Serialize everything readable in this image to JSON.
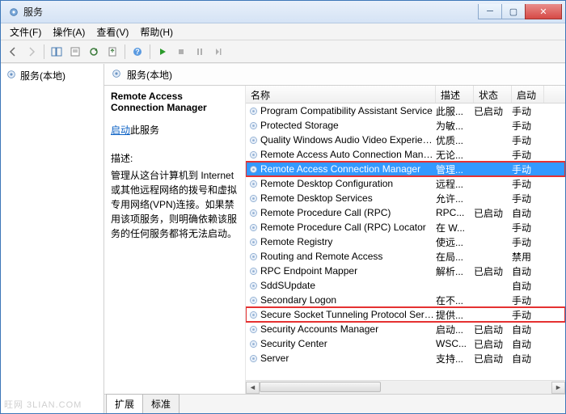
{
  "window": {
    "title": "服务"
  },
  "menu": {
    "file": "文件(F)",
    "action": "操作(A)",
    "view": "查看(V)",
    "help": "帮助(H)"
  },
  "tree": {
    "root": "服务(本地)"
  },
  "rhead": {
    "title": "服务(本地)"
  },
  "detail": {
    "name": "Remote Access Connection Manager",
    "start_link": "启动",
    "start_suffix": "此服务",
    "desc_label": "描述:",
    "desc": "管理从这台计算机到 Internet 或其他远程网络的拨号和虚拟专用网络(VPN)连接。如果禁用该项服务，则明确依赖该服务的任何服务都将无法启动。"
  },
  "cols": {
    "c1": "名称",
    "c2": "描述",
    "c3": "状态",
    "c4": "启动"
  },
  "rows": [
    {
      "n": "Program Compatibility Assistant Service",
      "d2": "此服...",
      "d3": "已启动",
      "d4": "手动"
    },
    {
      "n": "Protected Storage",
      "d2": "为敏...",
      "d3": "",
      "d4": "手动"
    },
    {
      "n": "Quality Windows Audio Video Experience",
      "d2": "优质...",
      "d3": "",
      "d4": "手动"
    },
    {
      "n": "Remote Access Auto Connection Manager",
      "d2": "无论...",
      "d3": "",
      "d4": "手动"
    },
    {
      "n": "Remote Access Connection Manager",
      "d2": "管理...",
      "d3": "",
      "d4": "手动",
      "sel": true,
      "hl": true
    },
    {
      "n": "Remote Desktop Configuration",
      "d2": "远程...",
      "d3": "",
      "d4": "手动"
    },
    {
      "n": "Remote Desktop Services",
      "d2": "允许...",
      "d3": "",
      "d4": "手动"
    },
    {
      "n": "Remote Procedure Call (RPC)",
      "d2": "RPC...",
      "d3": "已启动",
      "d4": "自动"
    },
    {
      "n": "Remote Procedure Call (RPC) Locator",
      "d2": "在 W...",
      "d3": "",
      "d4": "手动"
    },
    {
      "n": "Remote Registry",
      "d2": "使远...",
      "d3": "",
      "d4": "手动"
    },
    {
      "n": "Routing and Remote Access",
      "d2": "在局...",
      "d3": "",
      "d4": "禁用"
    },
    {
      "n": "RPC Endpoint Mapper",
      "d2": "解析...",
      "d3": "已启动",
      "d4": "自动"
    },
    {
      "n": "SddSUpdate",
      "d2": "",
      "d3": "",
      "d4": "自动"
    },
    {
      "n": "Secondary Logon",
      "d2": "在不...",
      "d3": "",
      "d4": "手动"
    },
    {
      "n": "Secure Socket Tunneling Protocol Service",
      "d2": "提供...",
      "d3": "",
      "d4": "手动",
      "hl": true
    },
    {
      "n": "Security Accounts Manager",
      "d2": "启动...",
      "d3": "已启动",
      "d4": "自动"
    },
    {
      "n": "Security Center",
      "d2": "WSC...",
      "d3": "已启动",
      "d4": "自动"
    },
    {
      "n": "Server",
      "d2": "支持...",
      "d3": "已启动",
      "d4": "自动"
    }
  ],
  "tabs": {
    "ext": "扩展",
    "std": "标准"
  },
  "watermark": "旺网 3LIAN.COM"
}
